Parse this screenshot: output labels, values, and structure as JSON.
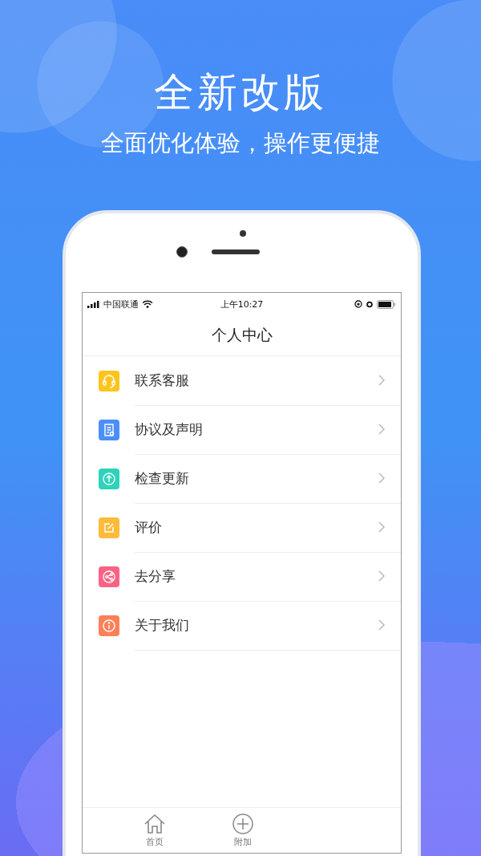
{
  "headline": "全新改版",
  "subtitle": "全面优化体验，操作更便捷",
  "status_bar": {
    "carrier": "中国联通",
    "time": "上午10:27"
  },
  "screen_title": "个人中心",
  "menu": [
    {
      "label": "联系客服",
      "kind": "headset",
      "color": "#fdc51c"
    },
    {
      "label": "协议及声明",
      "kind": "document",
      "color": "#4b8ff7"
    },
    {
      "label": "检查更新",
      "kind": "upload",
      "color": "#2dd3bb"
    },
    {
      "label": "评价",
      "kind": "edit",
      "color": "#fdbb3a"
    },
    {
      "label": "去分享",
      "kind": "share",
      "color": "#f86385"
    },
    {
      "label": "关于我们",
      "kind": "info",
      "color": "#fd8058"
    }
  ],
  "tab_bar": [
    {
      "label": "首页",
      "kind": "home"
    },
    {
      "label": "附加",
      "kind": "plus"
    }
  ]
}
